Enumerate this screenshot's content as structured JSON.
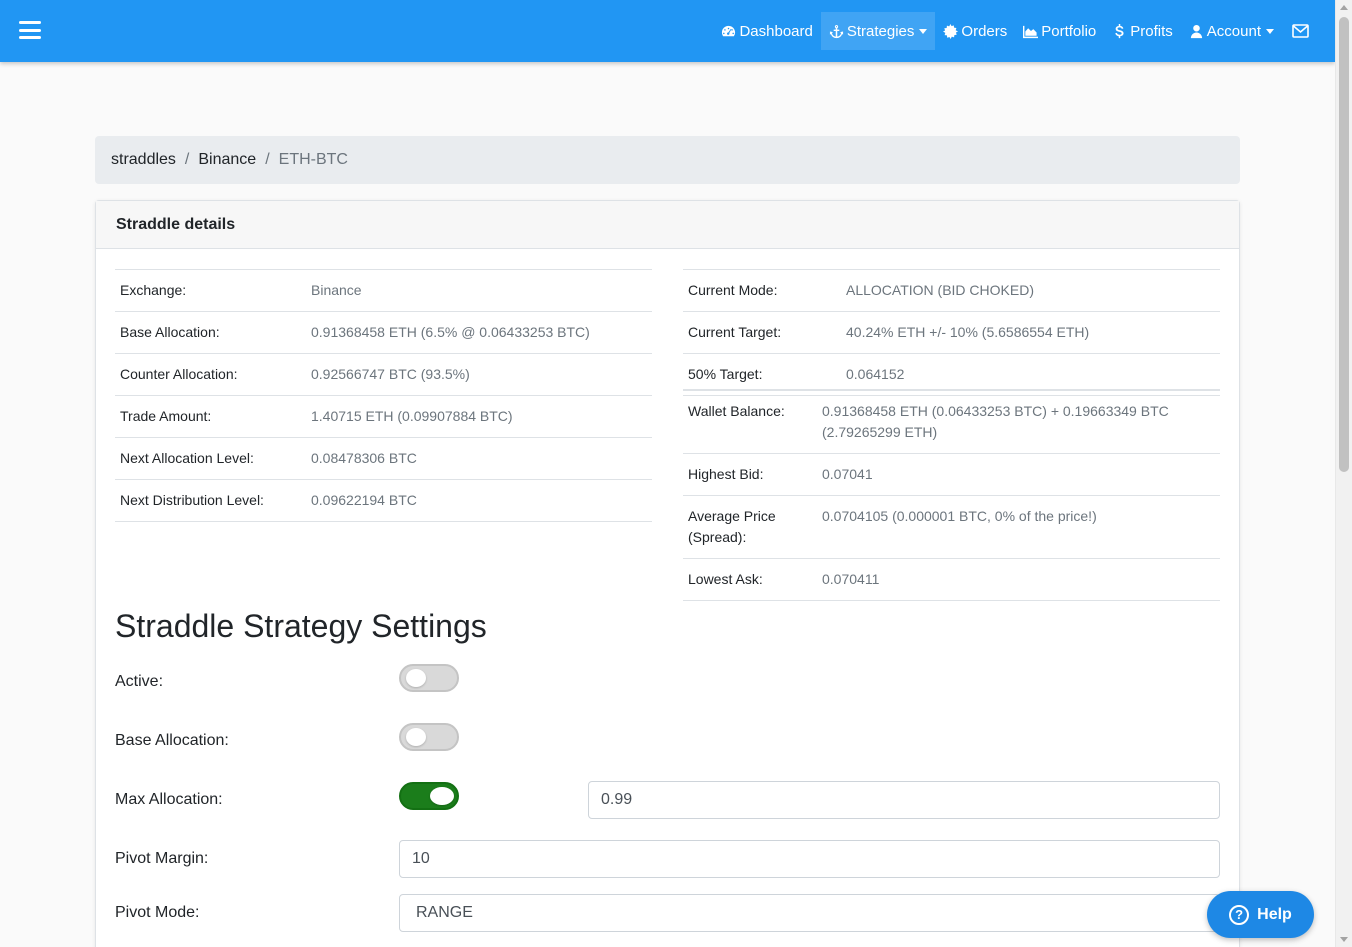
{
  "nav": {
    "items": [
      {
        "name": "nav-dashboard",
        "icon": "tachometer-icon",
        "label": "Dashboard"
      },
      {
        "name": "nav-strategies",
        "icon": "anchor-icon",
        "label": "Strategies"
      },
      {
        "name": "nav-orders",
        "icon": "gear-icon",
        "label": "Orders"
      },
      {
        "name": "nav-portfolio",
        "icon": "area-chart-icon",
        "label": "Portfolio"
      },
      {
        "name": "nav-profits",
        "icon": "dollar-icon",
        "label": "Profits"
      },
      {
        "name": "nav-account",
        "icon": "user-icon",
        "label": "Account"
      }
    ],
    "mail_icon": "envelope-icon",
    "color": "#2196f3"
  },
  "breadcrumb": {
    "items": [
      "straddles",
      "Binance"
    ],
    "current": "ETH-BTC",
    "separator": "/"
  },
  "card": {
    "title": "Straddle details"
  },
  "details_left": [
    {
      "key": "Exchange:",
      "value": "Binance"
    },
    {
      "key": "Base Allocation:",
      "value": "0.91368458 ETH (6.5% @ 0.06433253 BTC)"
    },
    {
      "key": "Counter Allocation:",
      "value": "0.92566747 BTC (93.5%)"
    },
    {
      "key": "Trade Amount:",
      "value": "1.40715 ETH (0.09907884 BTC)"
    },
    {
      "key": "Next Allocation Level:",
      "value": "0.08478306 BTC"
    },
    {
      "key": "Next Distribution Level:",
      "value": "0.09622194 BTC"
    }
  ],
  "details_right_top": [
    {
      "key": "Current Mode:",
      "value": "ALLOCATION (BID CHOKED)"
    },
    {
      "key": "Current Target:",
      "value": "40.24% ETH +/- 10% (5.6586554 ETH)"
    },
    {
      "key": "50% Target:",
      "value": "0.064152"
    }
  ],
  "details_right_bottom": [
    {
      "key": "Wallet Balance:",
      "value": "0.91368458 ETH (0.06433253 BTC) + 0.19663349 BTC (2.79265299 ETH)"
    },
    {
      "key": "Highest Bid:",
      "value": "0.07041"
    },
    {
      "key": "Average Price (Spread):",
      "value": "0.0704105 (0.000001 BTC, 0% of the price!)"
    },
    {
      "key": "Lowest Ask:",
      "value": "0.070411"
    }
  ],
  "settings": {
    "title": "Straddle Strategy Settings",
    "active_label": "Active:",
    "active_on": false,
    "base_allocation_label": "Base Allocation:",
    "base_allocation_on": false,
    "max_allocation_label": "Max Allocation:",
    "max_allocation_on": true,
    "max_allocation_value": "0.99",
    "pivot_margin_label": "Pivot Margin:",
    "pivot_margin_value": "10",
    "pivot_mode_label": "Pivot Mode:",
    "pivot_mode_value": "RANGE"
  },
  "help": {
    "label": "Help",
    "icon": "question-circle-icon"
  }
}
